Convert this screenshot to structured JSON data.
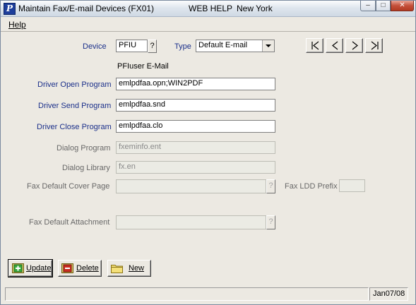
{
  "window": {
    "title": "Maintain Fax/E-mail Devices (FX01)",
    "help_label": "WEB HELP",
    "location": "New York",
    "app_icon_letter": "P",
    "minimize": "–",
    "maximize": "□",
    "close": "✕"
  },
  "menu": {
    "help": "Help"
  },
  "form": {
    "device": {
      "label": "Device",
      "value": "PFIU",
      "lookup": "?"
    },
    "type": {
      "label": "Type",
      "value": "Default E-mail"
    },
    "device_description": "PFIuser E-Mail",
    "driver_open": {
      "label": "Driver Open Program",
      "value": "emlpdfaa.opn;WIN2PDF"
    },
    "driver_send": {
      "label": "Driver Send Program",
      "value": "emlpdfaa.snd"
    },
    "driver_close": {
      "label": "Driver Close Program",
      "value": "emlpdfaa.clo"
    },
    "dialog_program": {
      "label": "Dialog Program",
      "value": "fxeminfo.ent"
    },
    "dialog_library": {
      "label": "Dialog Library",
      "value": "fx.en"
    },
    "fax_cover": {
      "label": "Fax Default Cover Page",
      "value": "",
      "lookup": "?"
    },
    "fax_ldd_prefix": {
      "label": "Fax LDD Prefix",
      "value": ""
    },
    "fax_attachment": {
      "label": "Fax Default Attachment",
      "value": "",
      "lookup": "?"
    }
  },
  "nav": {
    "first_icon": "first-record-icon",
    "prev_icon": "previous-record-icon",
    "next_icon": "next-record-icon",
    "last_icon": "last-record-icon"
  },
  "actions": {
    "update": "Update",
    "delete": "Delete",
    "new": "New"
  },
  "status": {
    "message": "",
    "date": "Jan07/08"
  },
  "colors": {
    "label_blue": "#1a2f8a",
    "disabled_label": "#686868",
    "window_bg": "#ece9e2"
  }
}
